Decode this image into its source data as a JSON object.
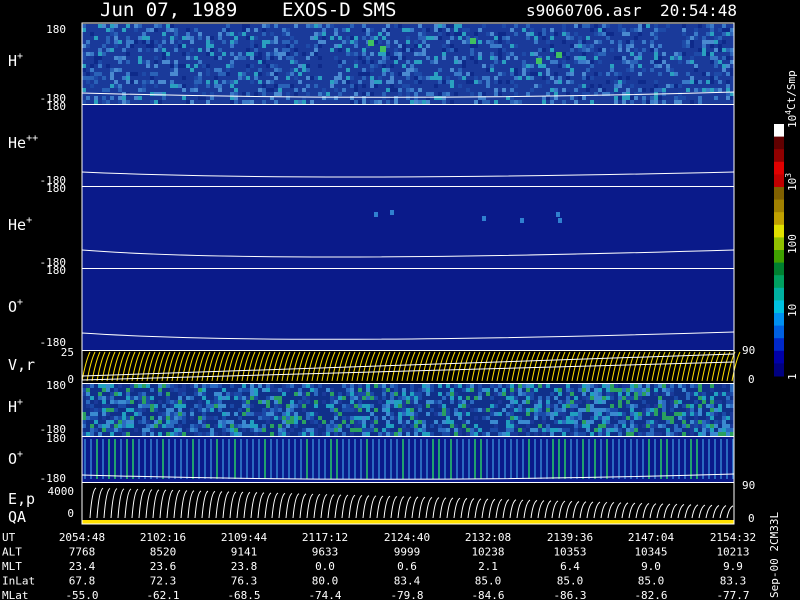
{
  "header": {
    "date": "Jun 07, 1989",
    "instrument": "EXOS-D SMS",
    "filename": "s9060706.asr",
    "time": "20:54:48"
  },
  "chart_data": {
    "type": "heatmap",
    "panels": [
      {
        "id": "h1",
        "label": "H",
        "sup": "+",
        "ymax": "180",
        "ymin": "-180",
        "kind": "spectrogram",
        "activity": "high"
      },
      {
        "id": "hepp",
        "label": "He",
        "sup": "++",
        "ymax": "180",
        "ymin": "-180",
        "kind": "spectrogram",
        "activity": "none"
      },
      {
        "id": "hep",
        "label": "He",
        "sup": "+",
        "ymax": "180",
        "ymin": "-180",
        "kind": "spectrogram",
        "activity": "sparse"
      },
      {
        "id": "op",
        "label": "O",
        "sup": "+",
        "ymax": "180",
        "ymin": "-180",
        "kind": "spectrogram",
        "activity": "none"
      },
      {
        "id": "vr",
        "label": "V,r",
        "sup": "",
        "ymax": "25",
        "ymin": "0",
        "right_top": "90",
        "right_bottom": "0",
        "kind": "line",
        "activity": "line"
      },
      {
        "id": "h2",
        "label": "H",
        "sup": "+",
        "ymax": "180",
        "ymin": "-180",
        "kind": "spectrogram",
        "activity": "high2"
      },
      {
        "id": "o2",
        "label": "O",
        "sup": "+",
        "ymax": "180",
        "ymin": "-180",
        "kind": "spectrogram",
        "activity": "medium"
      },
      {
        "id": "ep",
        "label": "E,p",
        "sup": "",
        "ymax": "4000",
        "ymin": "0",
        "right_top": "90",
        "right_bottom": "0",
        "kind": "line",
        "activity": "line"
      }
    ],
    "qa_label": "QA",
    "colorbar": {
      "unit": "Ct/Smp",
      "ticks": [
        {
          "base": "1",
          "exp": "",
          "value": 1
        },
        {
          "base": "10",
          "exp": "",
          "value": 10
        },
        {
          "base": "100",
          "exp": "",
          "value": 100
        },
        {
          "base": "10",
          "exp": "3",
          "value": 1000
        },
        {
          "base": "10",
          "exp": "4",
          "value": 10000
        }
      ],
      "colors": [
        "#000080",
        "#0000a8",
        "#0028c8",
        "#0060e0",
        "#0090f0",
        "#00c0e0",
        "#00b0a0",
        "#00a060",
        "#008030",
        "#40a000",
        "#90c000",
        "#e0e000",
        "#c0a000",
        "#a08000",
        "#806000",
        "#c00000",
        "#e00000",
        "#900000",
        "#600000",
        "#ffffff"
      ]
    },
    "footer_rows": [
      {
        "label": "UT",
        "values": [
          "2054:48",
          "2102:16",
          "2109:44",
          "2117:12",
          "2124:40",
          "2132:08",
          "2139:36",
          "2147:04",
          "2154:32"
        ]
      },
      {
        "label": "ALT",
        "values": [
          "7768",
          "8520",
          "9141",
          "9633",
          "9999",
          "10238",
          "10353",
          "10345",
          "10213"
        ]
      },
      {
        "label": "MLT",
        "values": [
          "23.4",
          "23.6",
          "23.8",
          "0.0",
          "0.6",
          "2.1",
          "6.4",
          "9.0",
          "9.9"
        ]
      },
      {
        "label": "InLat",
        "values": [
          "67.8",
          "72.3",
          "76.3",
          "80.0",
          "83.4",
          "85.0",
          "85.0",
          "85.0",
          "83.3"
        ]
      },
      {
        "label": "MLat",
        "values": [
          "-55.0",
          "-62.1",
          "-68.5",
          "-74.4",
          "-79.8",
          "-84.6",
          "-86.3",
          "-82.6",
          "-77.7"
        ]
      }
    ],
    "side_note": "Sep-00 2CM33L"
  }
}
